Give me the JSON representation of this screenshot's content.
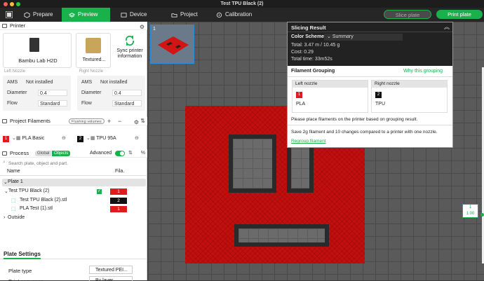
{
  "window": {
    "title": "Test TPU Black (2)"
  },
  "toolbar": {
    "tabs": [
      {
        "label": "Prepare"
      },
      {
        "label": "Preview"
      },
      {
        "label": "Device"
      },
      {
        "label": "Project"
      },
      {
        "label": "Calibration"
      }
    ],
    "slice_label": "Slice plate",
    "print_label": "Print plate"
  },
  "printer": {
    "section_title": "Printer",
    "model": "Bambu Lab H2D",
    "plate": "Textured...",
    "sync_label": "Sync printer information",
    "left_nozzle_label": "Left Nozzle",
    "right_nozzle_label": "Right Nozzle",
    "left": {
      "ams_label": "AMS",
      "ams_value": "Not installed",
      "diameter_label": "Diameter",
      "diameter_value": "0.4",
      "flow_label": "Flow",
      "flow_value": "Standard"
    },
    "right": {
      "ams_label": "AMS",
      "ams_value": "Not installed",
      "diameter_label": "Diameter",
      "diameter_value": "0.4",
      "flow_label": "Flow",
      "flow_value": "Standard"
    }
  },
  "filaments": {
    "section_title": "Project Filaments",
    "flushing_label": "Flushing volumes",
    "items": [
      {
        "num": "1",
        "name": "PLA Basic",
        "color": "#e01b1b"
      },
      {
        "num": "2",
        "name": "TPU 95A",
        "color": "#111111"
      }
    ]
  },
  "process": {
    "section_title": "Process",
    "global_label": "Global",
    "objects_label": "Objects",
    "advanced_label": "Advanced",
    "search_placeholder": "Search plate, object and part.",
    "col_name": "Name",
    "col_fila": "Fila.",
    "tree": [
      {
        "label": "Plate 1"
      },
      {
        "label": "Test TPU Black (2)",
        "fila": "1"
      },
      {
        "label": "Test TPU Black (2).stl",
        "fila": "2"
      },
      {
        "label": "PLA Test (1).stl",
        "fila": "1"
      },
      {
        "label": "Outside"
      }
    ]
  },
  "plate_settings": {
    "section_title": "Plate Settings",
    "plate_type_label": "Plate type",
    "plate_type_value": "Textured PEI...",
    "print_sequence_label": "Print sequence",
    "print_sequence_value": "By layer"
  },
  "thumb": {
    "number": "1"
  },
  "slicing": {
    "title": "Slicing Result",
    "color_scheme_label": "Color Scheme",
    "color_scheme_value": "Summary",
    "total_line": "Total:  3.47 m / 10.45 g",
    "cost_line": "Cost:  0.29",
    "time_line": "Total time:  33m52s",
    "grouping_label": "Filament Grouping",
    "why_label": "Why this grouping",
    "left_nozzle": "Left nozzle",
    "right_nozzle": "Right nozzle",
    "left_fil_num": "1",
    "left_fil_name": "PLA",
    "right_fil_num": "2",
    "right_fil_name": "TPU",
    "hint": "Please place filaments on the printer based on grouping result.",
    "save_text": "Save 2g filament and 10 changes compared to a printer with one nozzle.",
    "regroup_label": "Regroup filament"
  },
  "layer": {
    "top": "1",
    "value": "1.00"
  },
  "colors": {
    "accent": "#19b14c",
    "red": "#e01b1b",
    "model": "#c30e0e"
  }
}
